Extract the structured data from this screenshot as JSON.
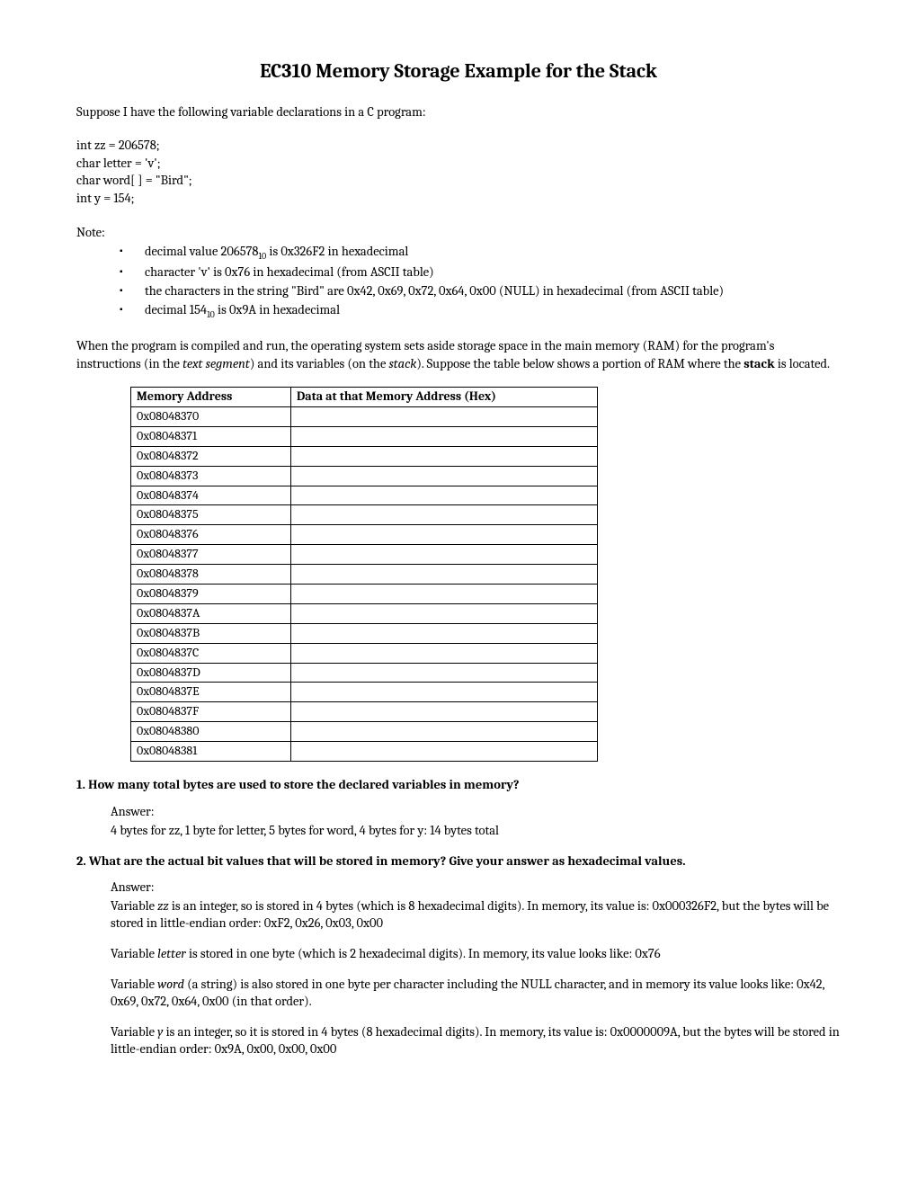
{
  "title": "EC310 Memory Storage Example for the Stack",
  "intro": "Suppose I have the following variable declarations in a C program:",
  "code": {
    "l1": "int  zz = 206578;",
    "l2": "char letter = 'v';",
    "l3": "char word[ ] = \"Bird\";",
    "l4": "int  y = 154;"
  },
  "noteLabel": "Note:",
  "notes": {
    "n1a": "decimal value 206578",
    "n1sub": "10",
    "n1b": " is 0x326F2 in hexadecimal",
    "n2": "character 'v' is 0x76 in hexadecimal (from ASCII table)",
    "n3": "the characters in the string \"Bird\" are 0x42, 0x69, 0x72, 0x64, 0x00 (NULL) in hexadecimal (from ASCII table)",
    "n4a": "decimal 154",
    "n4sub": "10",
    "n4b": " is 0x9A in hexadecimal"
  },
  "explain": {
    "p1a": "When the program is compiled and run, the operating system sets aside storage space in the main memory (RAM) for the program's instructions (in the ",
    "p1i": "text segment",
    "p1b": ") and its variables (on the ",
    "p1i2": "stack",
    "p1c": "). Suppose the table below shows a portion of RAM where the ",
    "p1bold": "stack",
    "p1d": " is located."
  },
  "table": {
    "h1": "Memory Address",
    "h2": "Data at that Memory Address (Hex)",
    "rows": [
      "0x08048370",
      "0x08048371",
      "0x08048372",
      "0x08048373",
      "0x08048374",
      "0x08048375",
      "0x08048376",
      "0x08048377",
      "0x08048378",
      "0x08048379",
      "0x0804837A",
      "0x0804837B",
      "0x0804837C",
      "0x0804837D",
      "0x0804837E",
      "0x0804837F",
      "0x08048380",
      "0x08048381"
    ]
  },
  "q1": "1.  How many total bytes are used to store the declared variables in memory?",
  "a1": {
    "label": "Answer:",
    "text": " 4 bytes for zz, 1 byte for letter, 5 bytes for word, 4 bytes for y: 14 bytes total"
  },
  "q2": "2.  What are the actual bit values that will be stored in memory? Give your answer as hexadecimal values.",
  "a2": {
    "label": "Answer:",
    "p1a": "Variable ",
    "p1i": "zz",
    "p1b": " is an integer, so is stored in 4 bytes (which is 8 hexadecimal digits). In memory, its value is: 0x000326F2, but the bytes will be stored in little-endian order: 0xF2, 0x26, 0x03, 0x00",
    "p2a": "Variable ",
    "p2i": "letter",
    "p2b": " is stored in one byte (which is 2 hexadecimal digits). In memory, its value looks like: 0x76",
    "p3a": "Variable ",
    "p3i": "word",
    "p3b": " (a string) is also stored in one byte per character including the NULL character, and in memory its value looks like: 0x42, 0x69, 0x72, 0x64, 0x00 (in that order).",
    "p4a": "Variable ",
    "p4i": "y",
    "p4b": " is an integer, so it is stored in 4 bytes (8 hexadecimal digits). In memory, its value is: 0x0000009A, but the bytes will be stored in little-endian order:  0x9A, 0x00, 0x00, 0x00"
  }
}
